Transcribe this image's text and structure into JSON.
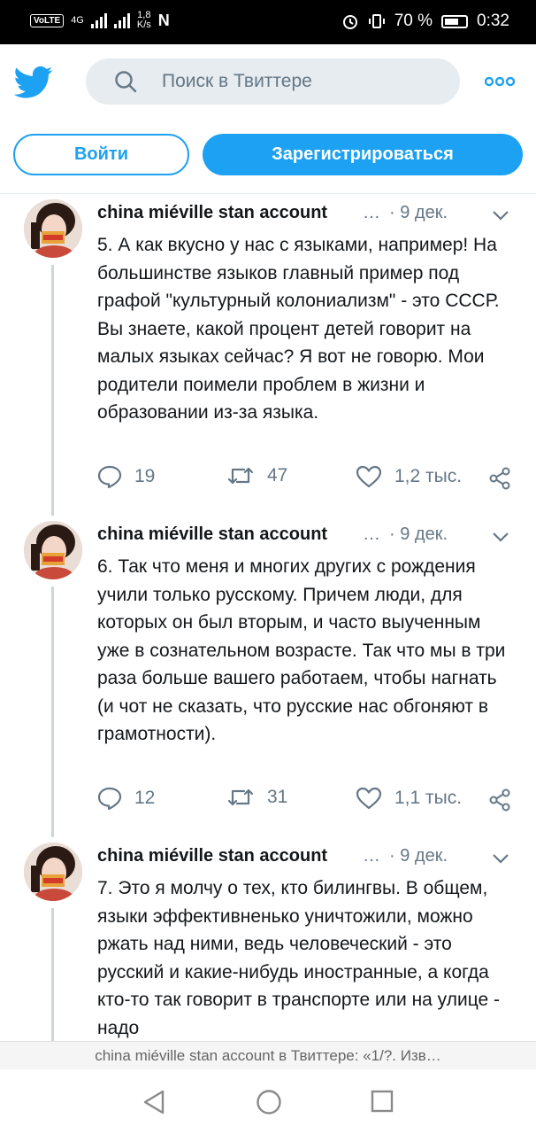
{
  "status_bar": {
    "volte": "VoLTE",
    "network": "4G",
    "speed_value": "1,8",
    "speed_unit": "K/s",
    "nfc": "N",
    "battery": "70 %",
    "battery_level": 0.7,
    "time": "0:32"
  },
  "search": {
    "placeholder": "Поиск в Твиттере"
  },
  "buttons": {
    "login": "Войти",
    "signup": "Зарегистрироваться"
  },
  "colors": {
    "accent": "#1da1f2",
    "muted": "#657786",
    "thread_line": "#ccd6dd"
  },
  "tweets": [
    {
      "author": "china miéville stan account",
      "ellipsis": "…",
      "date": "· 9 дек.",
      "text": "5. А как вкусно у нас с языками, например! На большинстве языков главный пример под графой \"культурный колониализм\" - это СССР. Вы знаете, какой процент детей говорит на малых языках сейчас? Я вот не говорю. Мои родители поимели проблем в жизни и образовании из-за языка.",
      "replies": "19",
      "retweets": "47",
      "likes": "1,2 тыс."
    },
    {
      "author": "china miéville stan account",
      "ellipsis": "…",
      "date": "· 9 дек.",
      "text": "6. Так что меня и многих других с рождения учили только русскому. Причем люди, для которых он был вторым, и часто выученным уже в сознательном возрасте. Так что мы в три раза больше вашего работаем, чтобы нагнать (и чот не сказать, что русские нас обгоняют в грамотности).",
      "replies": "12",
      "retweets": "31",
      "likes": "1,1 тыс."
    },
    {
      "author": "china miéville stan account",
      "ellipsis": "…",
      "date": "· 9 дек.",
      "text": "7. Это я молчу о тех, кто билингвы. В общем, языки эффективненько уничтожили, можно ржать над ними, ведь человеческий - это русский и какие-нибудь иностранные, а когда кто-то так говорит в транспорте или на улице - надо",
      "replies": "",
      "retweets": "",
      "likes": ""
    }
  ],
  "page_title": "china miéville stan account в Твиттере: «1/?. Изв…"
}
